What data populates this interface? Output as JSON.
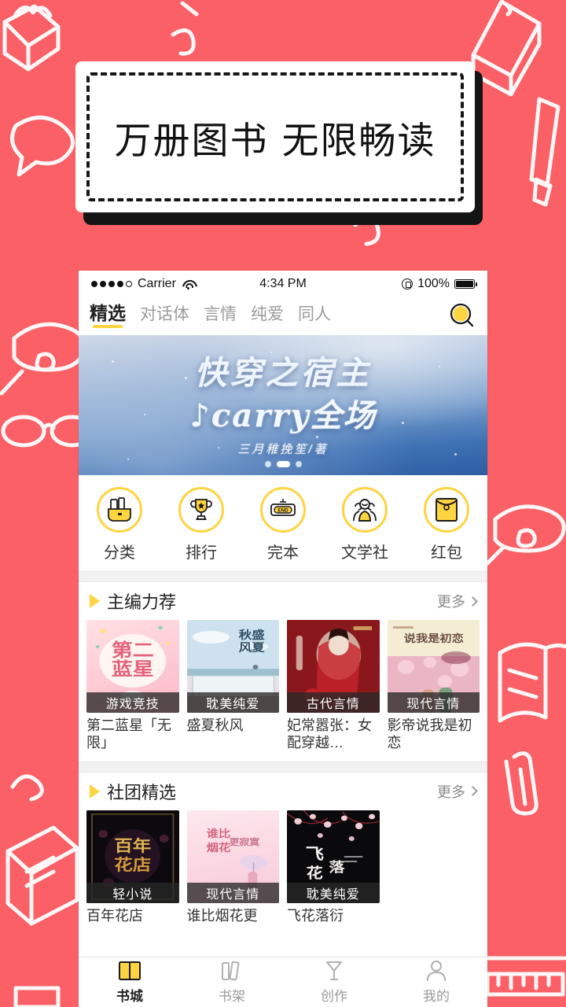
{
  "promo": {
    "headline": "万册图书  无限畅读"
  },
  "theme": {
    "background": "#FA6066",
    "accent_yellow": "#FFD441",
    "text_dark": "#222222",
    "text_muted": "#9A9A9A"
  },
  "statusbar": {
    "carrier": "Carrier",
    "time": "4:34 PM",
    "battery_percent": "100%",
    "signal_dots_filled": 4,
    "signal_dots_total": 5,
    "wifi_icon": "wifi-icon",
    "lock_icon": "rotation-lock-icon",
    "battery_icon": "battery-full-icon"
  },
  "navbar": {
    "tabs": [
      {
        "label": "精选",
        "active": true
      },
      {
        "label": "对话体",
        "active": false
      },
      {
        "label": "言情",
        "active": false
      },
      {
        "label": "纯爱",
        "active": false
      },
      {
        "label": "同人",
        "active": false
      }
    ],
    "search_icon": "search-icon"
  },
  "hero": {
    "line1": "快穿之宿主",
    "line2": "♪carry全场",
    "byline": "三月稚挽笙/著",
    "dots_total": 3,
    "dots_active_index": 1
  },
  "quicknav": [
    {
      "label": "分类",
      "icon": "category-books-icon"
    },
    {
      "label": "排行",
      "icon": "trophy-icon"
    },
    {
      "label": "完本",
      "icon": "end-sign-icon"
    },
    {
      "label": "文学社",
      "icon": "community-people-icon"
    },
    {
      "label": "红包",
      "icon": "red-envelope-icon"
    }
  ],
  "sections": [
    {
      "title": "主编力荐",
      "more_label": "更多",
      "books": [
        {
          "title": "第二蓝星「无限」",
          "badge": "游戏竞技",
          "cover": "pink"
        },
        {
          "title": "盛夏秋风",
          "badge": "耽美纯爱",
          "cover": "skyblue"
        },
        {
          "title": "妃常嚣张：女配穿越…",
          "badge": "古代言情",
          "cover": "darkred"
        },
        {
          "title": "影帝说我是初恋",
          "badge": "现代言情",
          "cover": "cream"
        }
      ]
    },
    {
      "title": "社团精选",
      "more_label": "更多",
      "books": [
        {
          "title": "百年花店",
          "badge": "轻小说",
          "cover": "black"
        },
        {
          "title": "谁比烟花更",
          "badge": "现代言情",
          "cover": "lightpink"
        },
        {
          "title": "飞花落衍",
          "badge": "耽美纯爱",
          "cover": "darkfloral"
        }
      ]
    }
  ],
  "tabbar": [
    {
      "label": "书城",
      "icon": "bookstore-icon",
      "active": true
    },
    {
      "label": "书架",
      "icon": "bookshelf-icon",
      "active": false
    },
    {
      "label": "创作",
      "icon": "pen-create-icon",
      "active": false
    },
    {
      "label": "我的",
      "icon": "profile-icon",
      "active": false
    }
  ]
}
